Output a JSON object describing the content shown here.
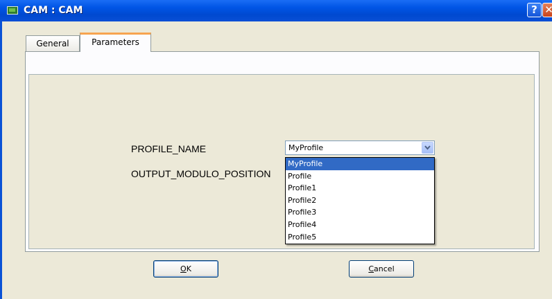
{
  "window": {
    "title": "CAM : CAM",
    "help_label": "?",
    "close_label": "✕"
  },
  "tabs": [
    {
      "label": "General",
      "active": false
    },
    {
      "label": "Parameters",
      "active": true
    }
  ],
  "parameters": {
    "profile_name_label": "PROFILE_NAME",
    "output_modulo_label": "OUTPUT_MODULO_POSITION",
    "profile_name_value": "MyProfile"
  },
  "dropdown": {
    "options": [
      "MyProfile",
      "Profile",
      "Profile1",
      "Profile2",
      "Profile3",
      "Profile4",
      "Profile5"
    ],
    "selected_index": 0
  },
  "buttons": {
    "ok_label": "OK",
    "cancel_label": "Cancel"
  },
  "colors": {
    "titlebar": "#0055e5",
    "tab_highlight": "#f7a44f",
    "selection": "#316ac5",
    "dialog_bg": "#ece9d8"
  }
}
